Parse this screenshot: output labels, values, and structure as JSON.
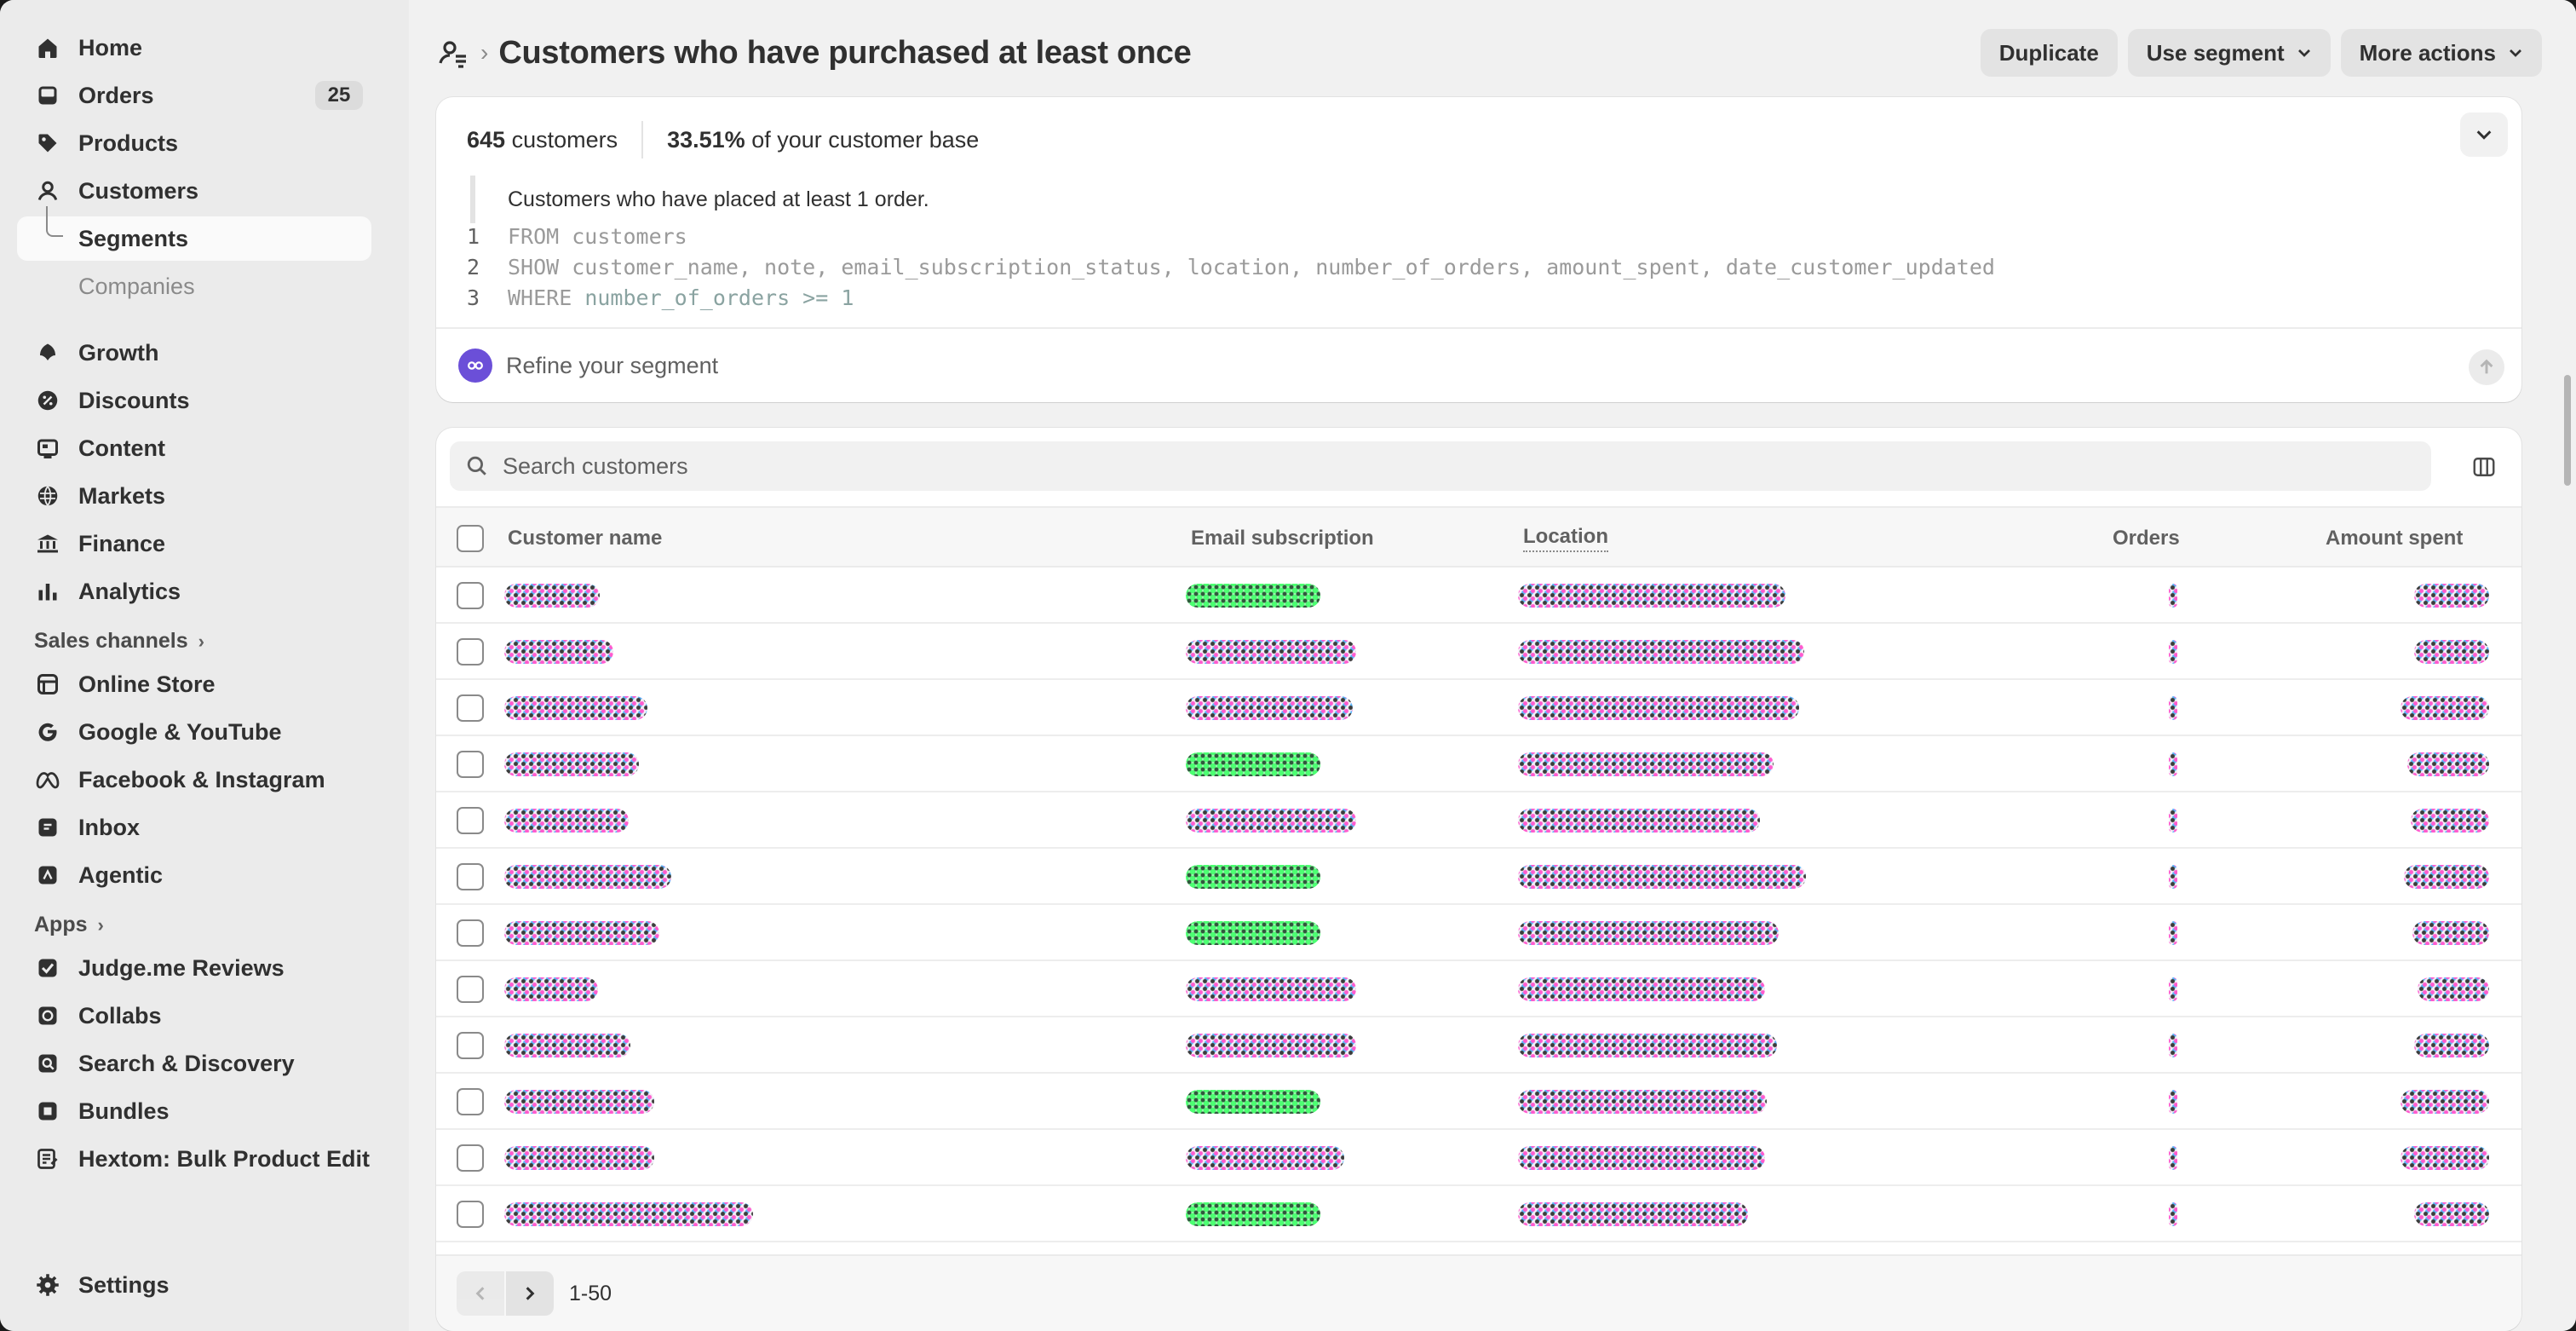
{
  "sidebar": {
    "primary": [
      {
        "label": "Home",
        "icon": "home-icon"
      },
      {
        "label": "Orders",
        "icon": "orders-icon",
        "badge": "25"
      },
      {
        "label": "Products",
        "icon": "tag-icon"
      },
      {
        "label": "Customers",
        "icon": "person-icon"
      }
    ],
    "customers_sub": [
      {
        "label": "Segments",
        "active": true
      },
      {
        "label": "Companies"
      }
    ],
    "secondary": [
      {
        "label": "Growth",
        "icon": "growth-icon"
      },
      {
        "label": "Discounts",
        "icon": "discount-icon"
      },
      {
        "label": "Content",
        "icon": "content-icon"
      },
      {
        "label": "Markets",
        "icon": "globe-icon"
      },
      {
        "label": "Finance",
        "icon": "bank-icon"
      },
      {
        "label": "Analytics",
        "icon": "bar-chart-icon"
      }
    ],
    "sales_channels_label": "Sales channels",
    "sales_channels": [
      {
        "label": "Online Store"
      },
      {
        "label": "Google & YouTube"
      },
      {
        "label": "Facebook & Instagram"
      },
      {
        "label": "Inbox"
      },
      {
        "label": "Agentic"
      }
    ],
    "apps_label": "Apps",
    "apps": [
      {
        "label": "Judge.me Reviews"
      },
      {
        "label": "Collabs"
      },
      {
        "label": "Search & Discovery"
      },
      {
        "label": "Bundles"
      },
      {
        "label": "Hextom: Bulk Product Edit"
      }
    ],
    "settings_label": "Settings"
  },
  "header": {
    "breadcrumb_separator": "›",
    "title": "Customers who have purchased at least once",
    "actions": {
      "duplicate": "Duplicate",
      "use_segment": "Use segment",
      "more_actions": "More actions"
    }
  },
  "summary": {
    "count": "645",
    "count_suffix": " customers",
    "percent": "33.51%",
    "percent_suffix": " of your customer base",
    "description": "Customers who have placed at least 1 order.",
    "code": [
      {
        "n": "1",
        "text": "FROM customers"
      },
      {
        "n": "2",
        "text": "SHOW customer_name, note, email_subscription_status, location, number_of_orders, amount_spent, date_customer_updated"
      },
      {
        "n": "3",
        "kw": "WHERE ",
        "text": "number_of_orders >= 1"
      }
    ],
    "refine_placeholder": "Refine your segment"
  },
  "table": {
    "search_placeholder": "Search customers",
    "columns": {
      "name": "Customer name",
      "email": "Email subscription",
      "location": "Location",
      "orders": "Orders",
      "amount": "Amount spent"
    },
    "pagination": {
      "range": "1-50"
    }
  },
  "colors": {
    "accent_active_bg": "#fafafa",
    "sidebar_bg": "#ebebeb",
    "page_bg": "#f1f1f1",
    "redacted_green": "#2dff5a"
  }
}
